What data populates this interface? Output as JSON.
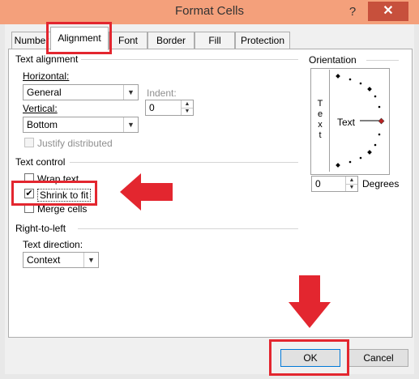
{
  "window": {
    "title": "Format Cells",
    "help_label": "?",
    "close_label": "✕"
  },
  "tabs": [
    "Number",
    "Alignment",
    "Font",
    "Border",
    "Fill",
    "Protection"
  ],
  "active_tab": "Alignment",
  "text_alignment": {
    "group_label": "Text alignment",
    "horizontal_label": "Horizontal:",
    "horizontal_value": "General",
    "indent_label": "Indent:",
    "indent_value": "0",
    "vertical_label": "Vertical:",
    "vertical_value": "Bottom",
    "justify_label": "Justify distributed"
  },
  "text_control": {
    "group_label": "Text control",
    "wrap_label": "Wrap text",
    "shrink_label": "Shrink to fit",
    "shrink_checked": true,
    "merge_label": "Merge cells"
  },
  "right_to_left": {
    "group_label": "Right-to-left",
    "direction_label": "Text direction:",
    "direction_value": "Context"
  },
  "orientation": {
    "group_label": "Orientation",
    "vertical_text": [
      "T",
      "e",
      "x",
      "t"
    ],
    "dial_text": "Text",
    "degrees_value": "0",
    "degrees_label": "Degrees"
  },
  "buttons": {
    "ok": "OK",
    "cancel": "Cancel"
  },
  "colors": {
    "titlebar": "#f4a07b",
    "close": "#c7503c",
    "annotation": "#e3262f"
  }
}
